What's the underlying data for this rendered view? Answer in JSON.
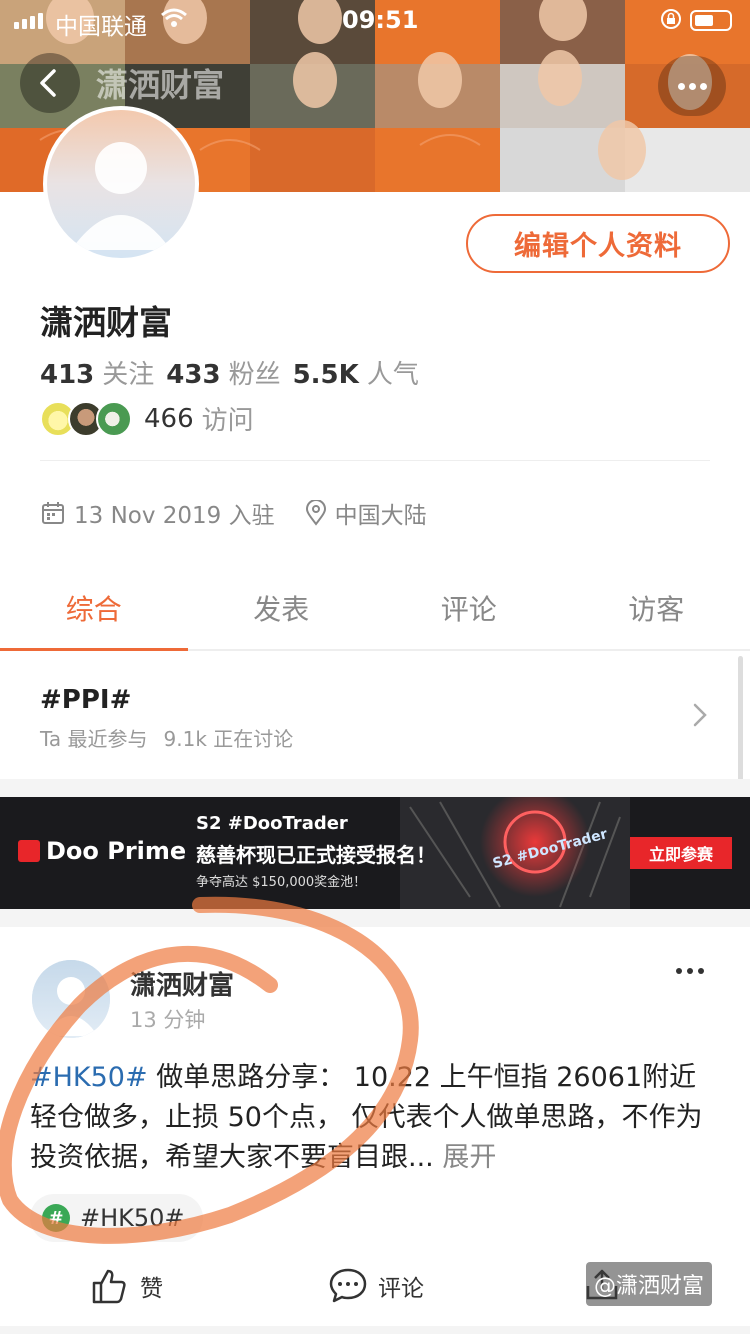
{
  "status_bar": {
    "carrier": "中国联通",
    "time": "09:51"
  },
  "header": {
    "title": "潇洒财富",
    "back_icon": "chevron-left-icon",
    "more_icon": "more-dots-icon"
  },
  "profile": {
    "edit_label": "编辑个人资料",
    "name": "潇洒财富",
    "following_count": "413",
    "following_label": "关注",
    "followers_count": "433",
    "followers_label": "粉丝",
    "popularity_count": "5.5K",
    "popularity_label": "人气",
    "visits_count": "466",
    "visits_label": "访问",
    "joined": "13 Nov 2019 入驻",
    "location": "中国大陆"
  },
  "tabs": [
    {
      "label": "综合",
      "active": true
    },
    {
      "label": "发表",
      "active": false
    },
    {
      "label": "评论",
      "active": false
    },
    {
      "label": "访客",
      "active": false
    }
  ],
  "topic": {
    "title": "#PPI#",
    "sub_prefix": "Ta 最近参与",
    "sub_count": "9.1k 正在讨论"
  },
  "ad": {
    "brand": "Doo Prime",
    "line1": "S2 #DooTrader",
    "line2": "慈善杯现已正式接受报名！",
    "line3": "争夺高达 $150,000奖金池！",
    "cta": "立即参赛",
    "art_text": "S2 #DooTrader"
  },
  "post": {
    "author": "潇洒财富",
    "time": "13 分钟",
    "tag": "#HK50#",
    "text": " 做单思路分享： 10.22 上午恒指 26061附近轻仓做多，止损 50个点， 仅代表个人做单思路，不作为投资依据，希望大家不要盲目跟...",
    "expand": " 展开",
    "chip_symbol": "#",
    "chip_label": "#HK50#"
  },
  "actions": {
    "like": "赞",
    "comment": "评论"
  },
  "watermark": "@潇洒财富",
  "colors": {
    "accent": "#ee6a38",
    "banner_orange": "#e8752c",
    "hashtag_blue": "#2b6cb0",
    "chip_green": "#3aa856",
    "ad_red": "#e8262a"
  }
}
